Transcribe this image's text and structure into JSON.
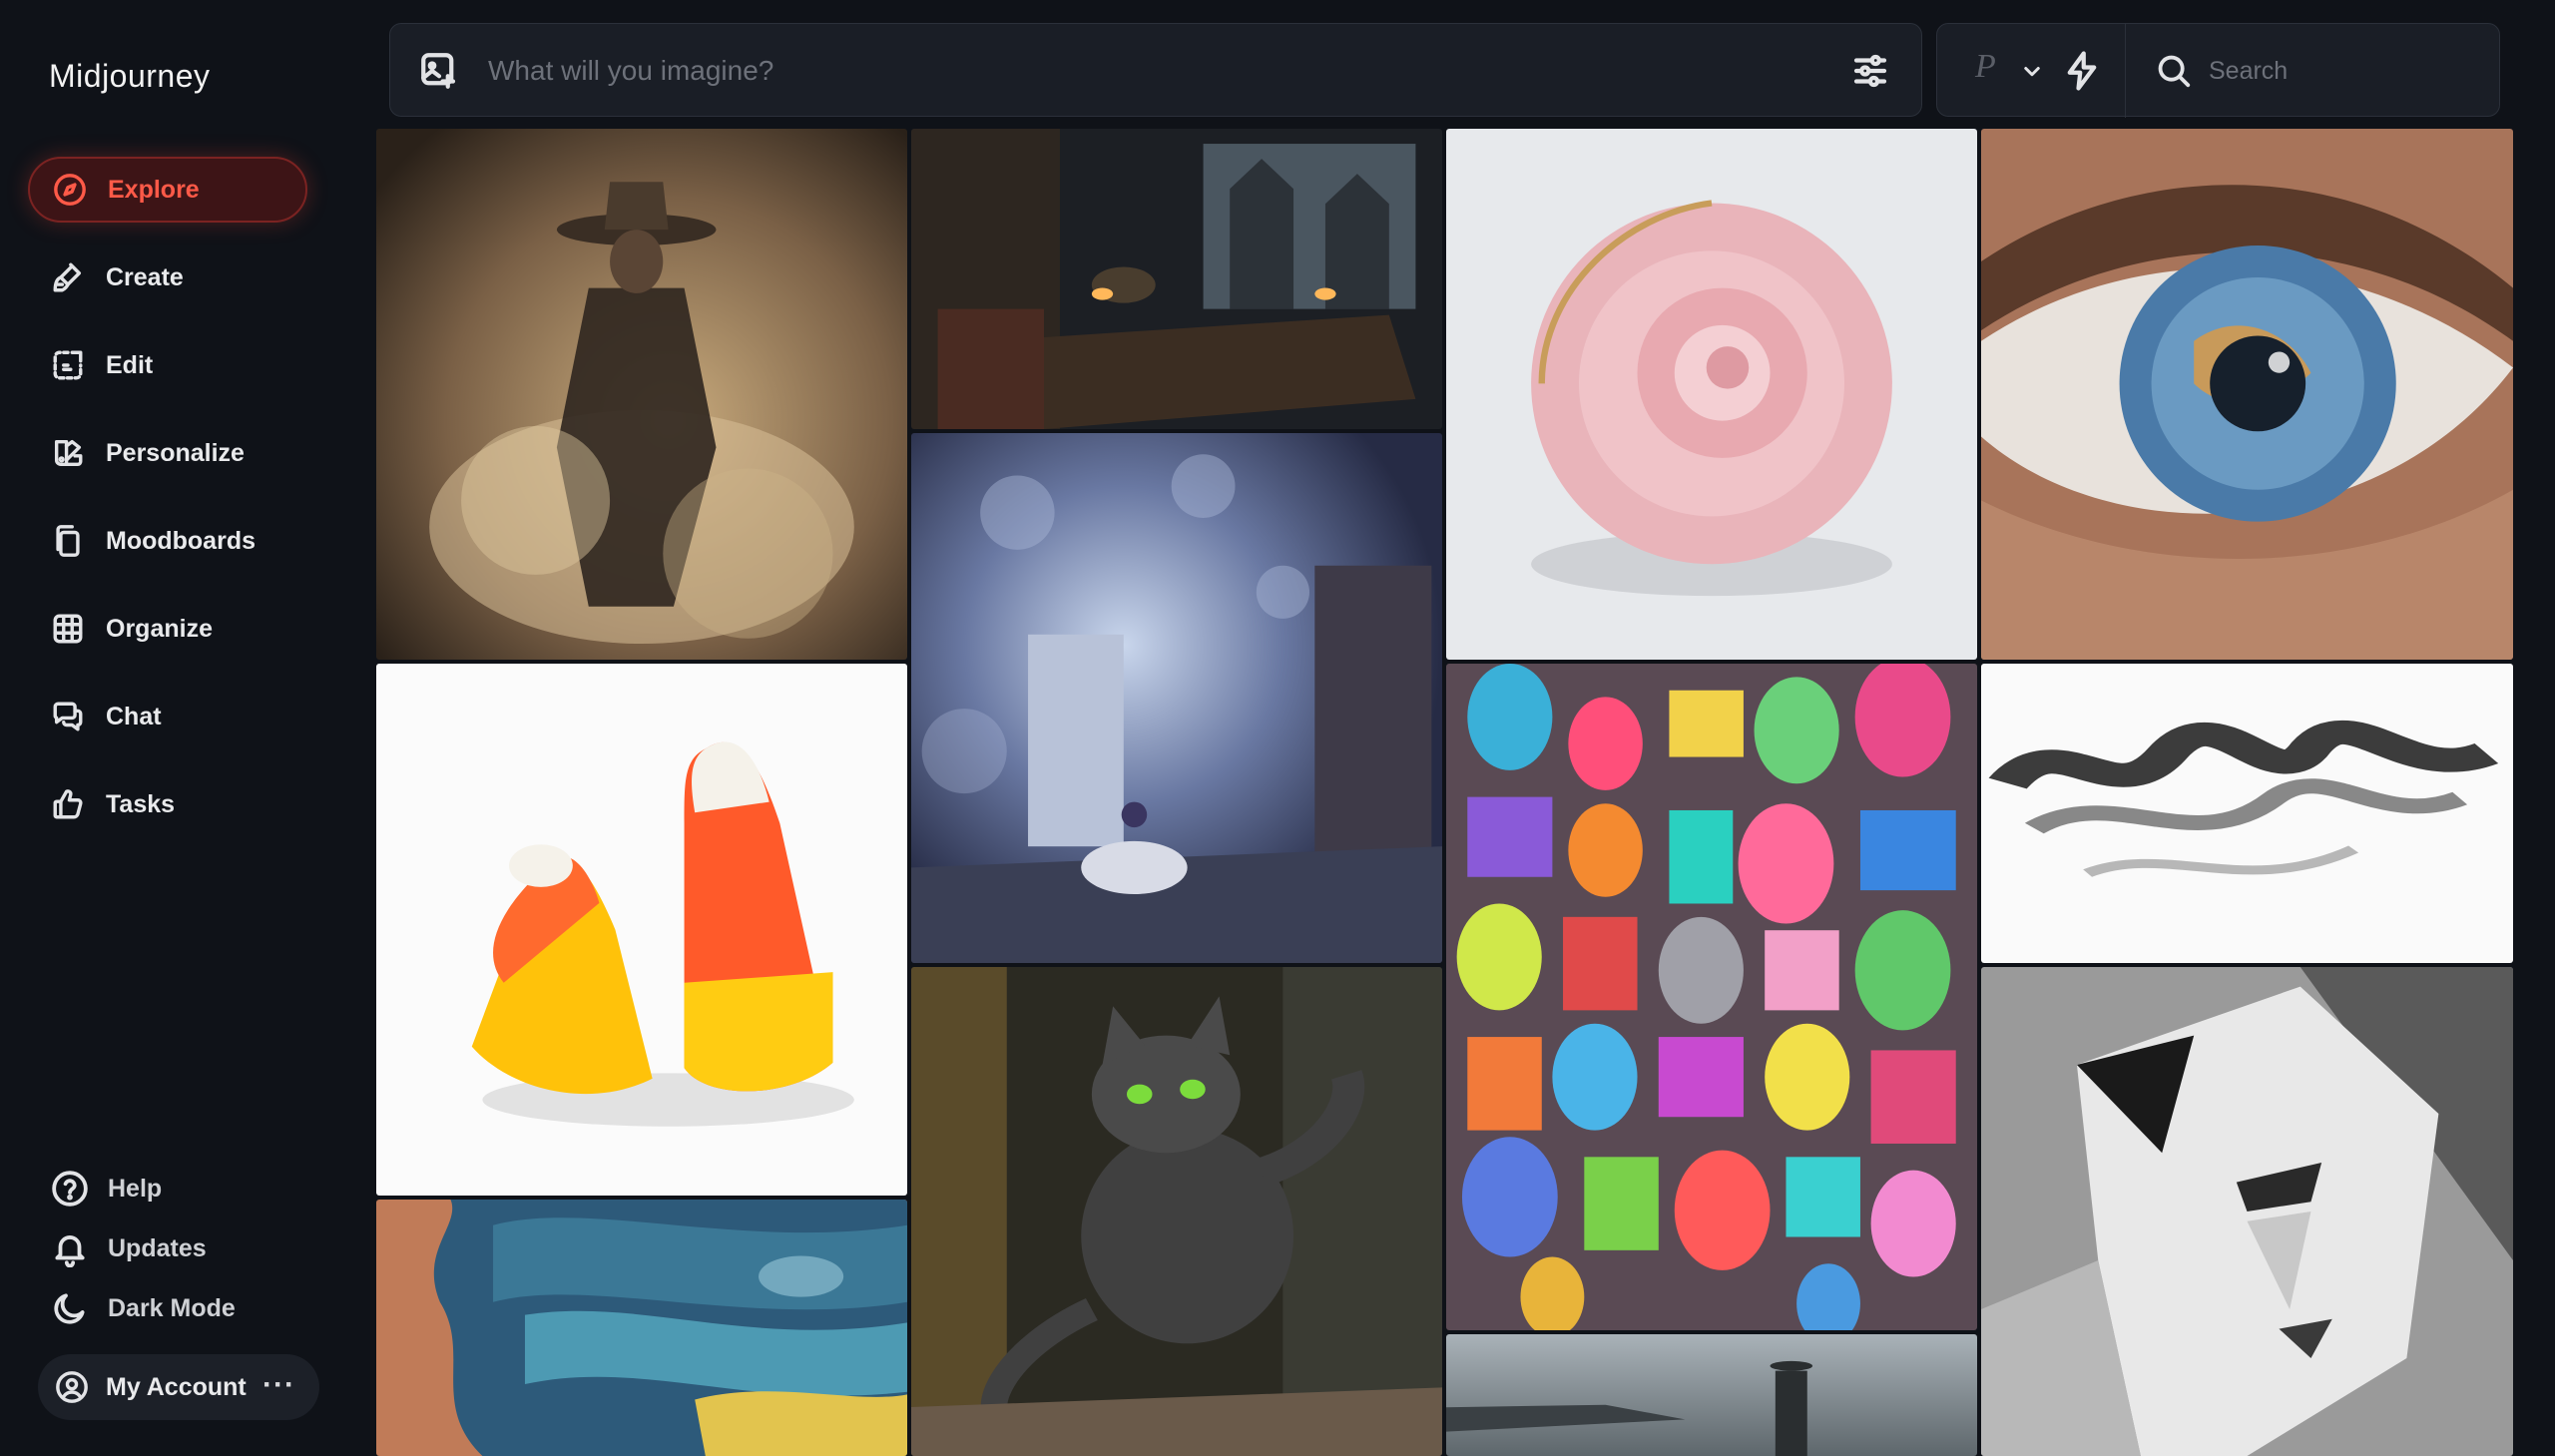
{
  "app": {
    "brand": "Midjourney"
  },
  "nav": {
    "items": [
      {
        "label": "Explore",
        "icon": "compass-icon",
        "active": true
      },
      {
        "label": "Create",
        "icon": "brush-icon"
      },
      {
        "label": "Edit",
        "icon": "edit-icon"
      },
      {
        "label": "Personalize",
        "icon": "personalize-icon"
      },
      {
        "label": "Moodboards",
        "icon": "moodboards-icon"
      },
      {
        "label": "Organize",
        "icon": "grid-icon"
      },
      {
        "label": "Chat",
        "icon": "chat-icon"
      },
      {
        "label": "Tasks",
        "icon": "thumbs-up-icon"
      }
    ]
  },
  "footer": {
    "help": "Help",
    "updates": "Updates",
    "dark_mode": "Dark Mode",
    "account": "My Account",
    "account_menu": "···"
  },
  "prompt": {
    "placeholder": "What will you imagine?"
  },
  "tools": {
    "personalize_glyph": "P",
    "search_placeholder": "Search"
  },
  "gallery": {
    "images": [
      "cowboy-dust-figure",
      "gothic-library-study",
      "pink-leather-rose-purse",
      "eye-with-earth-iris",
      "candy-corn",
      "girl-in-bubble-library",
      "sticker-collage-wall",
      "black-smoke-on-white",
      "dancing-cat",
      "layered-paper-clouds",
      "cubist-pierrot-mask",
      "man-by-sea-landscape"
    ]
  },
  "colors": {
    "background": "#0f1218",
    "panel": "#1a1e26",
    "accent": "#ff5a48",
    "accent_bg": "#3d1416"
  }
}
